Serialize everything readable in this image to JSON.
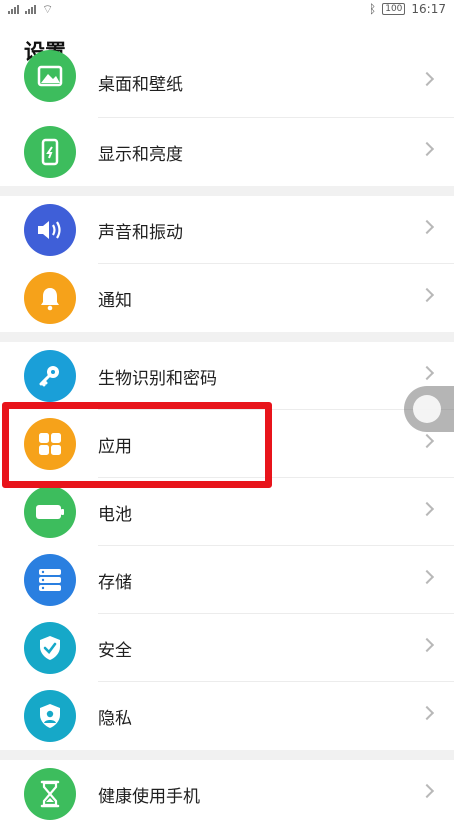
{
  "status_bar": {
    "left_text": "⁴⁶",
    "time": "16:17",
    "battery": "100"
  },
  "page": {
    "title": "设置"
  },
  "groups": [
    [
      {
        "key": "desktop",
        "label": "桌面和壁纸",
        "color": "#3dbd5d",
        "icon": "image-icon"
      },
      {
        "key": "display",
        "label": "显示和亮度",
        "color": "#3dbd5d",
        "icon": "phone-brightness-icon"
      }
    ],
    [
      {
        "key": "sound",
        "label": "声音和振动",
        "color": "#3f5fd8",
        "icon": "speaker-icon"
      },
      {
        "key": "notify",
        "label": "通知",
        "color": "#f6a21a",
        "icon": "bell-icon"
      }
    ],
    [
      {
        "key": "biometric",
        "label": "生物识别和密码",
        "color": "#1a9fd8",
        "icon": "key-icon"
      },
      {
        "key": "apps",
        "label": "应用",
        "color": "#f6a21a",
        "icon": "apps-grid-icon"
      },
      {
        "key": "battery",
        "label": "电池",
        "color": "#3dbd5d",
        "icon": "battery-icon"
      },
      {
        "key": "storage",
        "label": "存储",
        "color": "#2a7fe0",
        "icon": "storage-icon"
      },
      {
        "key": "security",
        "label": "安全",
        "color": "#16a8c8",
        "icon": "shield-check-icon"
      },
      {
        "key": "privacy",
        "label": "隐私",
        "color": "#16a8c8",
        "icon": "privacy-shield-icon"
      }
    ],
    [
      {
        "key": "health",
        "label": "健康使用手机",
        "color": "#3dbd5d",
        "icon": "hourglass-icon"
      }
    ]
  ]
}
